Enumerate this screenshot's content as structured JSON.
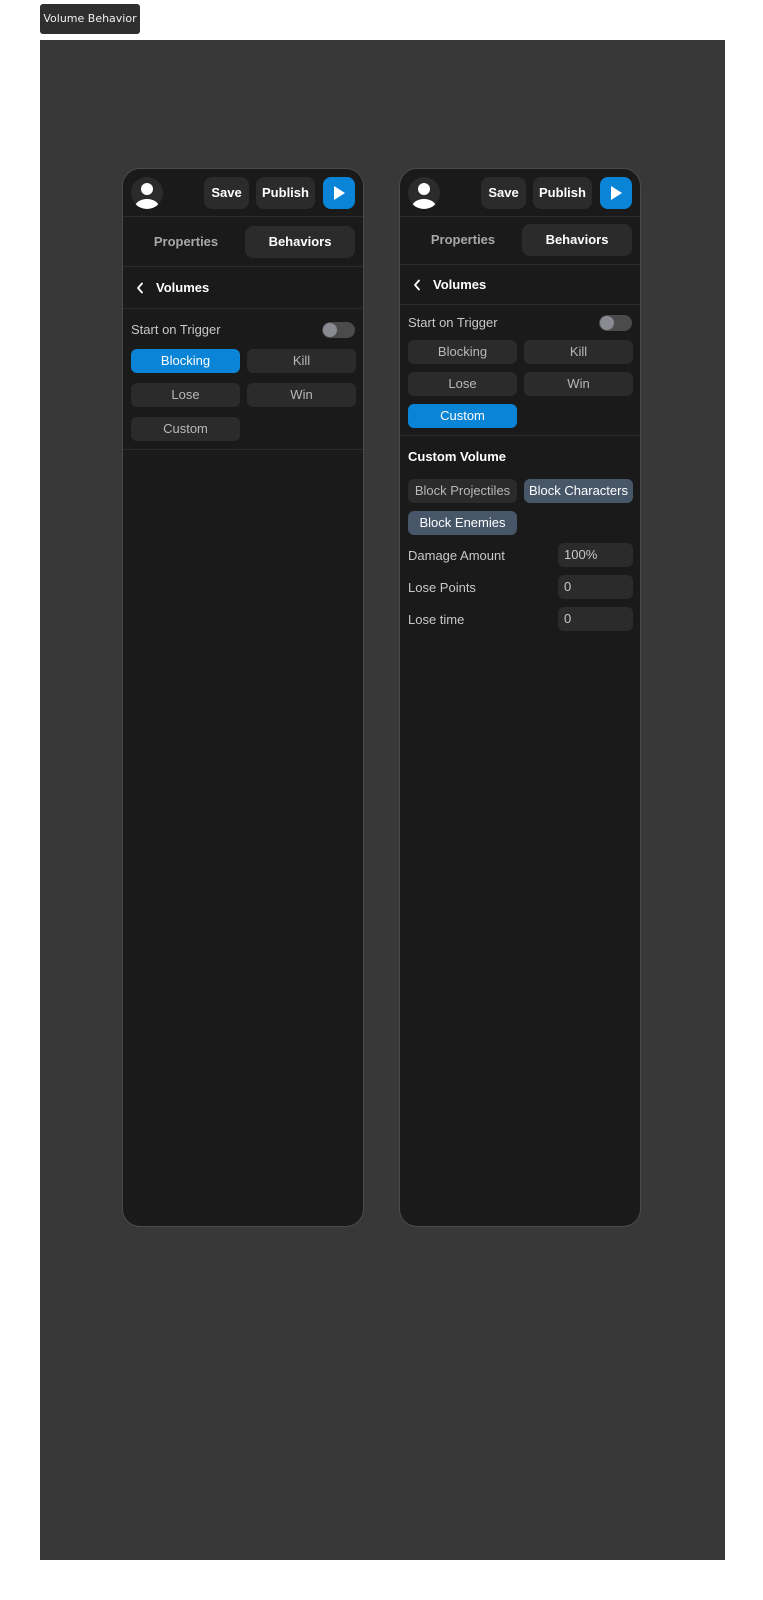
{
  "frame": {
    "label": "Volume Behavior"
  },
  "colors": {
    "accent": "#0a84d6",
    "selected": "#475669",
    "panel": "#1a1a1a",
    "canvas": "#383838"
  },
  "panels": [
    {
      "toolbar": {
        "save": "Save",
        "publish": "Publish",
        "play_icon": "play-icon",
        "avatar_icon": "user-icon"
      },
      "tabs": {
        "properties": "Properties",
        "behaviors": "Behaviors",
        "active": "Behaviors"
      },
      "section": {
        "back_icon": "chevron-left-icon",
        "title": "Volumes"
      },
      "start_on_trigger": {
        "label": "Start on Trigger",
        "enabled": false
      },
      "volume_types": [
        {
          "label": "Blocking",
          "active": true
        },
        {
          "label": "Kill",
          "active": false
        },
        {
          "label": "Lose",
          "active": false
        },
        {
          "label": "Win",
          "active": false
        },
        {
          "label": "Custom",
          "active": false
        }
      ]
    },
    {
      "toolbar": {
        "save": "Save",
        "publish": "Publish",
        "play_icon": "play-icon",
        "avatar_icon": "user-icon"
      },
      "tabs": {
        "properties": "Properties",
        "behaviors": "Behaviors",
        "active": "Behaviors"
      },
      "section": {
        "back_icon": "chevron-left-icon",
        "title": "Volumes"
      },
      "start_on_trigger": {
        "label": "Start on Trigger",
        "enabled": false
      },
      "volume_types": [
        {
          "label": "Blocking",
          "active": false
        },
        {
          "label": "Kill",
          "active": false
        },
        {
          "label": "Lose",
          "active": false
        },
        {
          "label": "Win",
          "active": false
        },
        {
          "label": "Custom",
          "active": true
        }
      ],
      "custom_volume": {
        "title": "Custom Volume",
        "options": [
          {
            "label": "Block Projectiles",
            "selected": false
          },
          {
            "label": "Block Characters",
            "selected": true
          },
          {
            "label": "Block Enemies",
            "selected": true
          }
        ],
        "fields": [
          {
            "label": "Damage Amount",
            "value": "100%"
          },
          {
            "label": "Lose Points",
            "value": "0"
          },
          {
            "label": "Lose time",
            "value": "0"
          }
        ]
      }
    }
  ]
}
